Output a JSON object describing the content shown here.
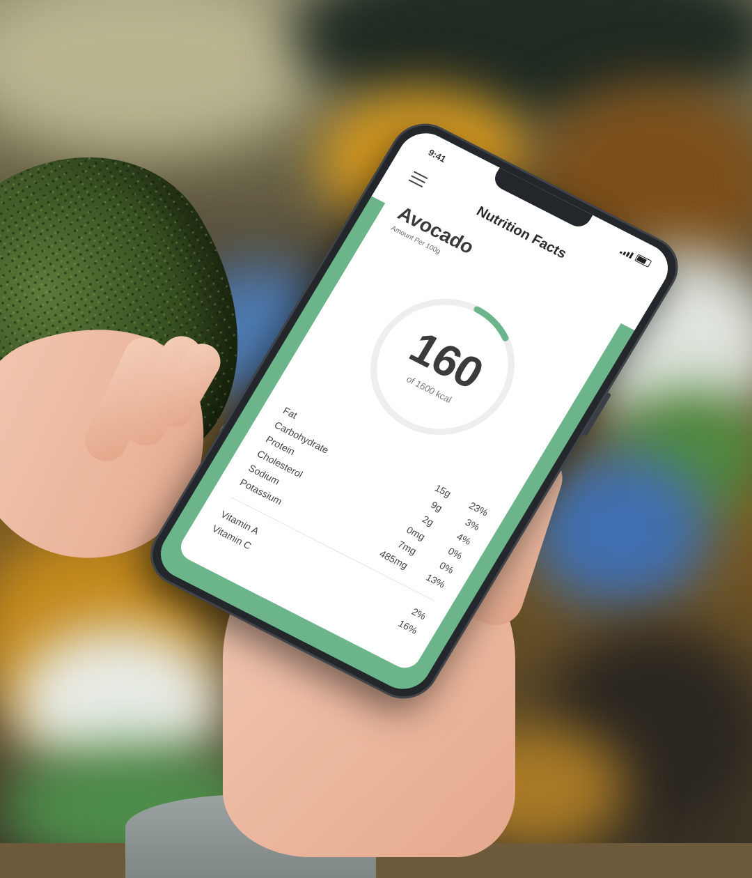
{
  "status_bar": {
    "time": "9:41"
  },
  "app": {
    "title": "Nutrition Facts"
  },
  "food": {
    "name": "Avocado",
    "serving": "Amount Per 100g"
  },
  "calories": {
    "value": "160",
    "goal_text": "of 1600 kcal",
    "progress_fraction": 0.1,
    "ring_color": "#6cb48a",
    "ring_track_color": "#eeeeee"
  },
  "nutrients": [
    {
      "name": "Fat",
      "amount": "15g",
      "percent": "23%"
    },
    {
      "name": "Carbohydrate",
      "amount": "9g",
      "percent": "3%"
    },
    {
      "name": "Protein",
      "amount": "2g",
      "percent": "4%"
    },
    {
      "name": "Cholesterol",
      "amount": "0mg",
      "percent": "0%"
    },
    {
      "name": "Sodium",
      "amount": "7mg",
      "percent": "0%"
    },
    {
      "name": "Potassium",
      "amount": "485mg",
      "percent": "13%"
    }
  ],
  "vitamins": [
    {
      "name": "Vitamin A",
      "percent": "2%"
    },
    {
      "name": "Vitamin C",
      "percent": "16%"
    }
  ],
  "colors": {
    "accent": "#6cb48a",
    "card": "#ffffff",
    "phone_frame": "#23262b"
  },
  "icons": [
    "menu-icon",
    "signal-icon",
    "battery-icon"
  ]
}
